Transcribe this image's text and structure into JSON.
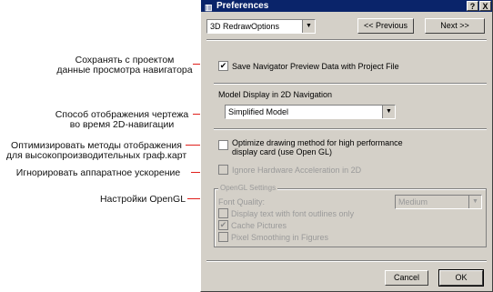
{
  "annotations": [
    {
      "text": "Сохранять с проектом\nданные просмотра навигатора"
    },
    {
      "text": "Способ отображения чертежа\nво время 2D-навигации"
    },
    {
      "text": "Оптимизировать методы отображения\nдля высокопроизводительных граф.карт"
    },
    {
      "text": "Игнорировать аппаратное ускорение"
    },
    {
      "text": "Настройки OpenGL"
    }
  ],
  "dialog": {
    "title": "Preferences",
    "help_btn": "?",
    "close_btn": "X",
    "page_select": "3D RedrawOptions",
    "prev_btn": "<< Previous",
    "next_btn": "Next >>",
    "save_nav_label": "Save Navigator Preview Data with Project File",
    "save_nav_checked": true,
    "model_display_label": "Model Display in 2D Navigation",
    "model_display_value": "Simplified Model",
    "optimize_label": "Optimize drawing method for high performance\ndisplay card (use Open GL)",
    "optimize_checked": false,
    "ignore_hw_label": "Ignore Hardware Acceleration in 2D",
    "ignore_hw_checked": false,
    "opengl": {
      "group_title": "OpenGL Settings",
      "font_quality_label": "Font Quality:",
      "font_quality_value": "Medium",
      "display_text_label": "Display text with font outlines only",
      "display_text_checked": false,
      "cache_label": "Cache Pictures",
      "cache_checked": true,
      "pixel_label": "Pixel Smoothing in Figures",
      "pixel_checked": false
    },
    "cancel_btn": "Cancel",
    "ok_btn": "OK"
  },
  "colors": {
    "arrow": "#e0201c",
    "titlebar": "#0a246a",
    "dialog_bg": "#d4d0c8"
  }
}
